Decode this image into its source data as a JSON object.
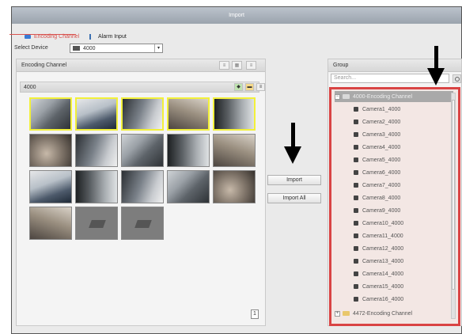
{
  "window": {
    "title": "Import"
  },
  "tabs": [
    {
      "label": "Encoding Channel",
      "active": true
    },
    {
      "label": "Alarm Input",
      "active": false
    }
  ],
  "device": {
    "label": "Select Device",
    "value": "4000"
  },
  "left_panel": {
    "title": "Encoding Channel",
    "sub_title": "4000",
    "page": "1"
  },
  "buttons": {
    "import": "Import",
    "import_all": "Import All"
  },
  "group_panel": {
    "title": "Group",
    "search_placeholder": "Search...",
    "root": "4000-Encoding Channel",
    "cameras": [
      "Camera1_4000",
      "Camera2_4000",
      "Camera3_4000",
      "Camera4_4000",
      "Camera5_4000",
      "Camera6_4000",
      "Camera7_4000",
      "Camera8_4000",
      "Camera9_4000",
      "Camera10_4000",
      "Camera11_4000",
      "Camera12_4000",
      "Camera13_4000",
      "Camera14_4000",
      "Camera15_4000",
      "Camera16_4000"
    ],
    "second_group": "4472-Encoding Channel"
  },
  "colors": {
    "accent": "#d9534f",
    "highlight": "#d94444",
    "selection": "#f2f03a"
  },
  "icons": [
    "encoding-channel-icon",
    "alarm-input-icon",
    "device-icon",
    "search-icon",
    "folder-icon",
    "camera-icon",
    "arrow-down-icon"
  ]
}
